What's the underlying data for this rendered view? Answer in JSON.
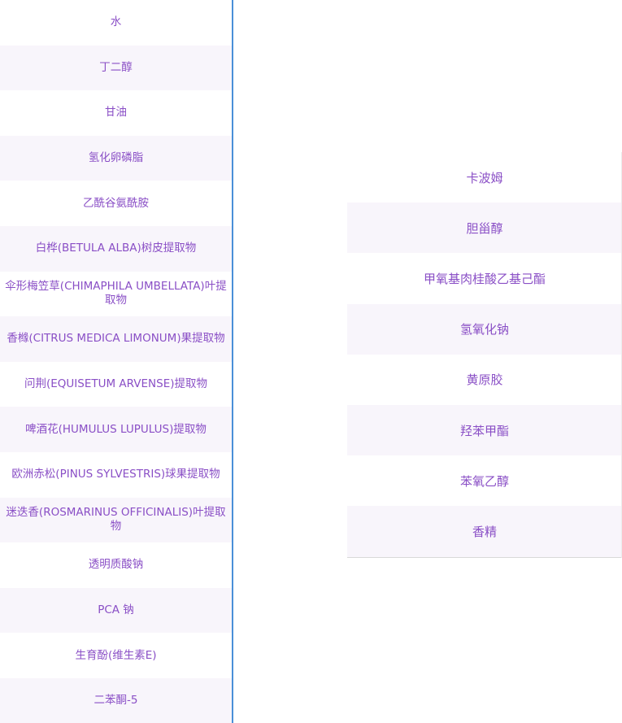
{
  "left_list": {
    "items": [
      "水",
      "丁二醇",
      "甘油",
      "氢化卵磷脂",
      "乙酰谷氨酰胺",
      "白桦(BETULA ALBA)树皮提取物",
      "伞形梅笠草(CHIMAPHILA UMBELLATA)叶提取物",
      "香橼(CITRUS MEDICA LIMONUM)果提取物",
      "问荆(EQUISETUM ARVENSE)提取物",
      "啤酒花(HUMULUS LUPULUS)提取物",
      "欧洲赤松(PINUS SYLVESTRIS)球果提取物",
      "迷迭香(ROSMARINUS OFFICINALIS)叶提取物",
      "透明质酸钠",
      "PCA 钠",
      "生育酚(维生素E)",
      "二苯酮-5"
    ]
  },
  "right_list": {
    "items": [
      "卡波姆",
      "胆甾醇",
      "甲氧基肉桂酸乙基己酯",
      "氢氧化钠",
      "黄原胶",
      "羟苯甲酯",
      "苯氧乙醇",
      "香精"
    ]
  },
  "colors": {
    "text": "#8a4fc6",
    "stripe": "#f8f5fb",
    "divider": "#4a8fd8"
  }
}
